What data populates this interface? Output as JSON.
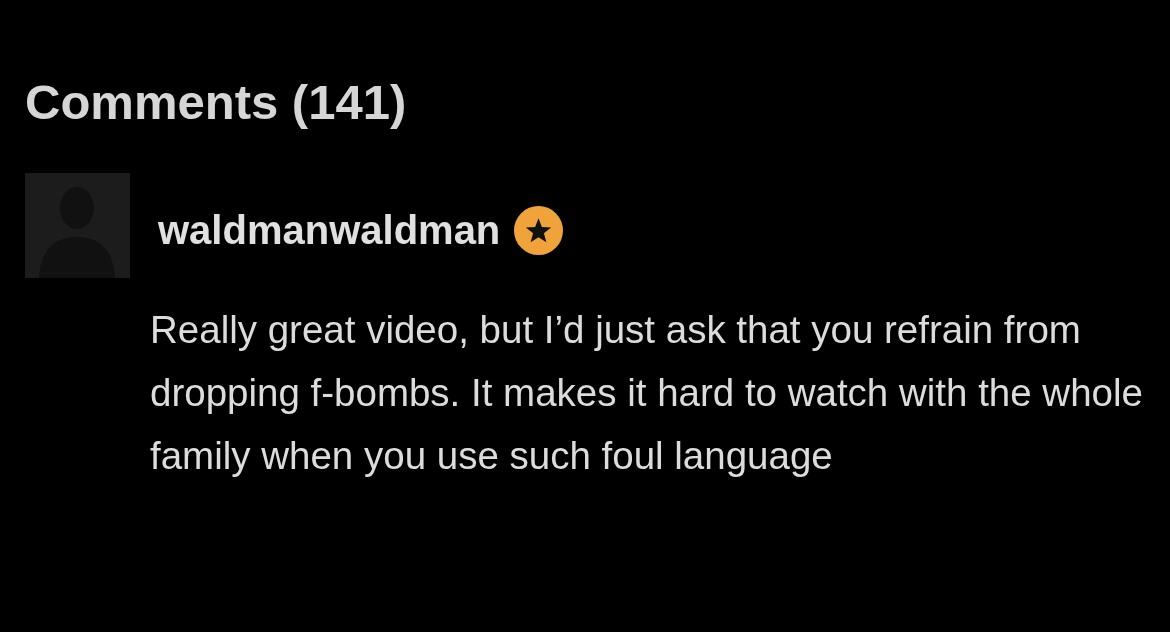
{
  "comments_header": {
    "title": "Comments (141)"
  },
  "comments": [
    {
      "username": "waldmanwaldman",
      "verified": true,
      "text": "Really great video, but I’d just ask that you refrain from dropping f-bombs. It makes it hard to watch with the whole family when you use such foul language"
    }
  ]
}
